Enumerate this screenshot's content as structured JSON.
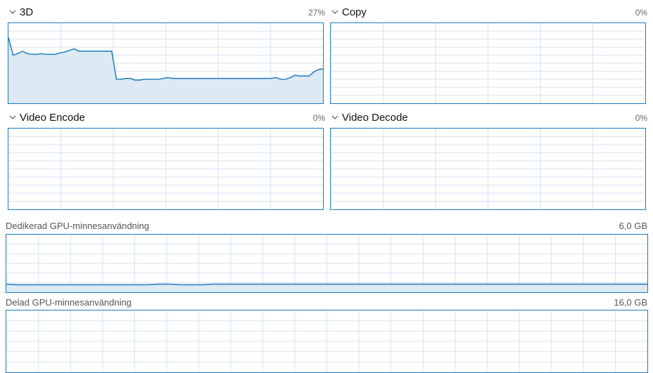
{
  "engines": [
    {
      "name": "3D",
      "percent": "27%"
    },
    {
      "name": "Copy",
      "percent": "0%"
    },
    {
      "name": "Video Encode",
      "percent": "0%"
    },
    {
      "name": "Video Decode",
      "percent": "0%"
    }
  ],
  "memory": {
    "dedicated": {
      "label": "Dedikerad GPU-minnesanvändning",
      "value": "6,0 GB"
    },
    "shared": {
      "label": "Delad GPU-minnesanvändning",
      "value": "16,0 GB"
    }
  },
  "series": {
    "engine_3d": [
      82,
      60,
      62,
      65,
      62,
      61,
      61,
      62,
      61,
      61,
      61,
      63,
      64,
      66,
      68,
      65,
      65,
      65,
      65,
      65,
      65,
      65,
      65,
      30,
      30,
      31,
      31,
      29,
      29,
      30,
      30,
      30,
      30,
      31,
      32,
      31,
      31,
      31,
      31,
      31,
      31,
      31,
      31,
      31,
      31,
      31,
      31,
      31,
      31,
      31,
      31,
      31,
      31,
      31,
      31,
      31,
      31,
      32,
      30,
      30,
      32,
      35,
      34,
      34,
      34,
      39,
      42,
      43
    ],
    "dedicated": [
      14,
      13,
      13,
      13,
      13,
      13,
      13,
      13,
      13,
      13,
      13,
      13,
      13,
      13,
      14,
      14,
      13,
      13,
      13,
      14,
      14,
      14,
      14,
      14,
      14,
      14,
      14,
      14,
      14,
      14,
      14,
      14,
      14,
      14,
      14,
      14,
      14,
      14,
      14,
      14,
      14,
      14,
      14,
      14,
      14,
      14,
      14,
      14,
      14,
      14,
      14,
      14,
      14,
      14,
      14,
      14,
      14,
      14,
      14,
      14
    ],
    "shared": []
  },
  "colors": {
    "line": "#1a7bbd",
    "fill": "#dde9f4",
    "grid": "#d5e3f0"
  }
}
